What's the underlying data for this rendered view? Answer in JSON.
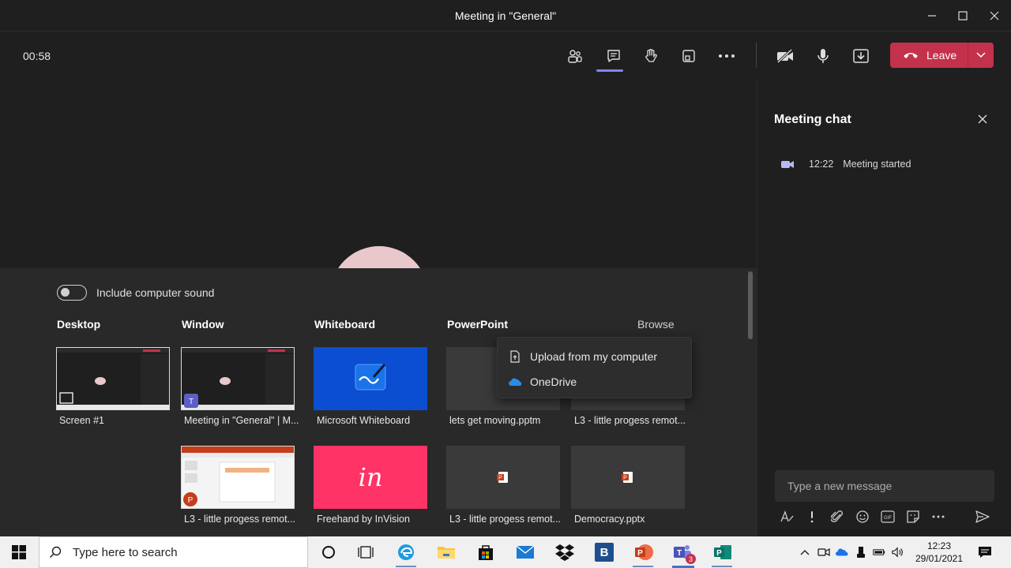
{
  "window": {
    "title": "Meeting in \"General\""
  },
  "toolbar": {
    "timer": "00:58",
    "leave_label": "Leave"
  },
  "share": {
    "include_sound_label": "Include computer sound",
    "sections": {
      "desktop": "Desktop",
      "window": "Window",
      "whiteboard": "Whiteboard",
      "powerpoint": "PowerPoint"
    },
    "browse_label": "Browse",
    "tiles": {
      "screen1": "Screen #1",
      "meeting_window": "Meeting in \"General\" | M...",
      "ppt_window": "L3 - little progess remot...",
      "ms_whiteboard": "Microsoft Whiteboard",
      "invision": "Freehand by InVision",
      "ppt1": "lets get moving.pptm",
      "ppt2": "L3 - little progess remot...",
      "ppt3": "L3 - little progess remot...",
      "ppt4": "Democracy.pptx"
    },
    "invision_logo": "in",
    "browse_menu": {
      "upload": "Upload from my computer",
      "onedrive": "OneDrive"
    }
  },
  "chat": {
    "title": "Meeting chat",
    "event": {
      "time": "12:22",
      "text": "Meeting started"
    },
    "input_placeholder": "Type a new message"
  },
  "taskbar": {
    "search_placeholder": "Type here to search",
    "time": "12:23",
    "date": "29/01/2021",
    "teams_badge": "3",
    "b_app": "B"
  },
  "colors": {
    "leave": "#c4314b",
    "accent": "#7f85f5",
    "whiteboard_tile": "#0b4ed1",
    "invision_tile": "#ff3366"
  }
}
